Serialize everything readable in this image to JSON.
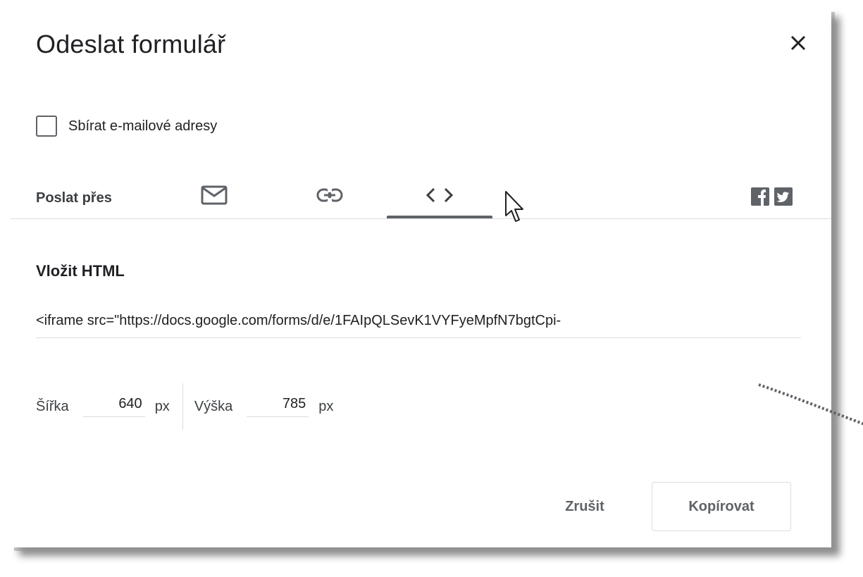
{
  "dialog": {
    "title": "Odeslat formulář",
    "collect_emails_label": "Sbírat e-mailové adresy",
    "collect_emails_checked": false,
    "send_via_label": "Poslat přes",
    "tabs": [
      {
        "icon": "email-icon",
        "active": false
      },
      {
        "icon": "link-icon",
        "active": false
      },
      {
        "icon": "embed-code-icon",
        "active": true
      }
    ],
    "social": [
      "facebook-icon",
      "twitter-icon"
    ],
    "embed": {
      "heading": "Vložit HTML",
      "code": "<iframe src=\"https://docs.google.com/forms/d/e/1FAIpQLSevK1VYFyeMpfN7bgtCpi-",
      "width_label": "Šířka",
      "width_value": "640",
      "width_unit": "px",
      "height_label": "Výška",
      "height_value": "785",
      "height_unit": "px"
    },
    "cancel_label": "Zrušit",
    "copy_label": "Kopírovat"
  },
  "colors": {
    "text": "#202124",
    "icon": "#5f6368",
    "divider": "#dadce0"
  }
}
